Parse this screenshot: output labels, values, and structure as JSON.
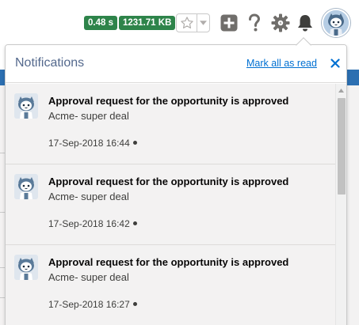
{
  "header": {
    "timing_badge": "0.48 s",
    "size_badge": "1231.71 KB",
    "icons": [
      "star-icon",
      "chevron-down-icon",
      "plus-icon",
      "help-icon",
      "gear-icon",
      "bell-icon",
      "avatar"
    ],
    "colors": {
      "badge": "#2e844a",
      "icon": "#706e6b"
    }
  },
  "notifications": {
    "title": "Notifications",
    "mark_all_label": "Mark all as read",
    "close_label": "×",
    "items": [
      {
        "title": "Approval request for the opportunity is approved",
        "subtitle": "Acme- super deal",
        "date": "17-Sep-2018 16:44"
      },
      {
        "title": "Approval request for the opportunity is approved",
        "subtitle": "Acme- super deal",
        "date": "17-Sep-2018 16:42"
      },
      {
        "title": "Approval request for the opportunity is approved",
        "subtitle": "Acme- super deal",
        "date": "17-Sep-2018 16:27"
      }
    ],
    "colors": {
      "link": "#0070d2",
      "list_bg": "#f3f2f2"
    }
  }
}
